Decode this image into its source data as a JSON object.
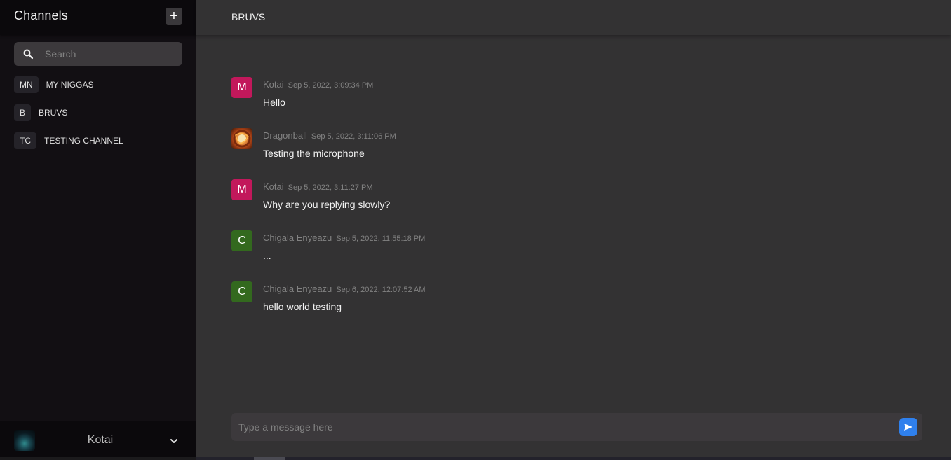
{
  "sidebar": {
    "title": "Channels",
    "add_button_label": "+",
    "search": {
      "placeholder": "Search",
      "value": ""
    },
    "channels": [
      {
        "abbr": "MN",
        "name": "MY NIGGAS"
      },
      {
        "abbr": "B",
        "name": "BRUVS"
      },
      {
        "abbr": "TC",
        "name": "TESTING CHANNEL"
      }
    ],
    "user": {
      "name": "Kotai"
    }
  },
  "main": {
    "channel_title": "BRUVS",
    "messages": [
      {
        "avatar_letter": "M",
        "avatar_color": "#c2185b",
        "author": "Kotai",
        "time": "Sep 5, 2022, 3:09:34 PM",
        "text": "Hello"
      },
      {
        "avatar_letter": "",
        "avatar_color": "#e2893a",
        "author": "Dragonball",
        "time": "Sep 5, 2022, 3:11:06 PM",
        "text": "Testing the microphone"
      },
      {
        "avatar_letter": "M",
        "avatar_color": "#c2185b",
        "author": "Kotai",
        "time": "Sep 5, 2022, 3:11:27 PM",
        "text": "Why are you replying slowly?"
      },
      {
        "avatar_letter": "C",
        "avatar_color": "#33691e",
        "author": "Chigala Enyeazu",
        "time": "Sep 5, 2022, 11:55:18 PM",
        "text": "..."
      },
      {
        "avatar_letter": "C",
        "avatar_color": "#33691e",
        "author": "Chigala Enyeazu",
        "time": "Sep 6, 2022, 12:07:52 AM",
        "text": "hello world testing"
      }
    ],
    "composer": {
      "placeholder": "Type a message here",
      "value": ""
    }
  },
  "icons": {
    "search": "search-icon",
    "add": "plus-icon",
    "chevron": "chevron-down-icon",
    "send": "send-icon"
  },
  "colors": {
    "sidebar_bg": "#120f13",
    "main_bg": "#333233",
    "accent": "#2f80ed"
  }
}
